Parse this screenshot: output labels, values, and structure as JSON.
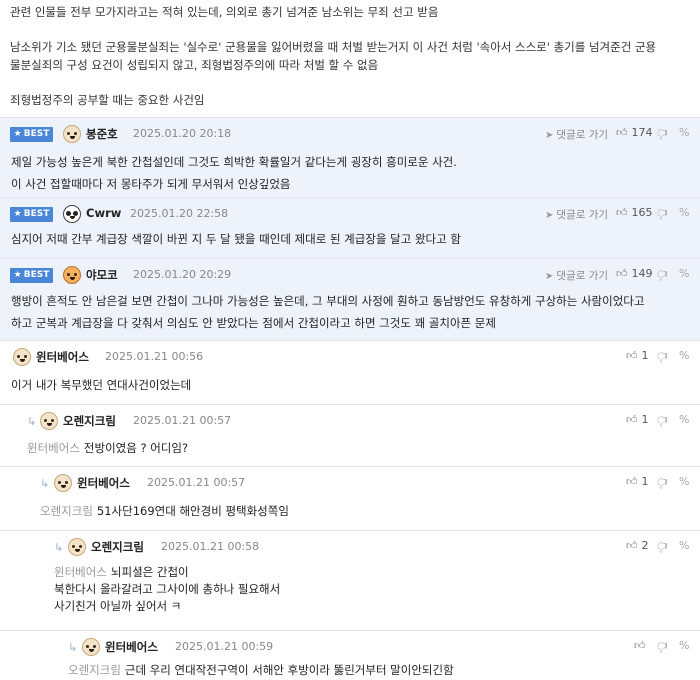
{
  "post_tail": {
    "line1": "관련 인물들 전부 모가지라고는 적혀 있는데, 의외로 총기 넘겨준 남소위는 무죄 선고 받음",
    "line2": "남소위가 기소 됐던 군용물분실죄는 '실수로' 군용물을 잃어버렸을 때 처벌 받는거지 이 사건 처럼 '속아서 스스로' 총기를 넘겨준건 군용",
    "line3": "물분실죄의 구성 요건이 성립되지 않고, 죄형법정주의에 따라 처벌 할 수 없음",
    "line4": "죄형법정주의 공부할 때는 중요한 사건임"
  },
  "ui": {
    "best_label": "BEST",
    "reply_label": "댓글로 가기"
  },
  "comments": [
    {
      "best": true,
      "nick": "봉준호",
      "date": "2025.01.20 20:18",
      "likes": "174",
      "lines": [
        "제일 가능성 높은게 북한 간첩설인데 그것도 희박한 확률일거 같다는게 굉장히 흥미로운 사건.",
        "이 사건 접할때마다 저 몽타주가 되게 무서워서 인상깊었음"
      ]
    },
    {
      "best": true,
      "nick": "Cwrw",
      "date": "2025.01.20 22:58",
      "likes": "165",
      "lines": [
        "심지어 저때 간부 계급장 색깔이 바뀐 지 두 달 됐을 때인데 제대로 된 계급장을 달고 왔다고 함"
      ]
    },
    {
      "best": true,
      "nick": "야모코",
      "date": "2025.01.20 20:29",
      "likes": "149",
      "lines": [
        "행방이 흔적도 안 남은걸 보면 간첩이 그나마 가능성은 높은데, 그 부대의 사정에 훤하고 동남방언도 유창하게 구상하는 사람이었다고",
        "하고 군복과 계급장을 다 갖춰서 의심도 안 받았다는 점에서 간첩이라고 하면 그것도 꽤 골치아픈 문제"
      ]
    },
    {
      "best": false,
      "nick": "윈터베어스",
      "date": "2025.01.21 00:56",
      "likes": "1",
      "mention": "",
      "lines": [
        "이거 내가 복무했던 연대사건이었는데"
      ]
    },
    {
      "best": false,
      "nick": "오렌지크림",
      "date": "2025.01.21 00:57",
      "likes": "1",
      "mention": "윈터베어스",
      "lines": [
        "전방이였음 ? 어디임?"
      ]
    },
    {
      "best": false,
      "nick": "윈터베어스",
      "date": "2025.01.21 00:57",
      "likes": "1",
      "mention": "오렌지크림",
      "lines": [
        "51사단169연대 해안경비 평택화성쪽임"
      ]
    },
    {
      "best": false,
      "nick": "오렌지크림",
      "date": "2025.01.21 00:58",
      "likes": "2",
      "mention": "윈터베어스",
      "lines": [
        "뇌피셜은 간첩이",
        "북한다시 올라갈려고 그사이에 총하나 필요해서",
        "사기친거 아닐까 싶어서 ㅋ"
      ]
    },
    {
      "best": false,
      "nick": "윈터베어스",
      "date": "2025.01.21 00:59",
      "likes": "",
      "mention": "오렌지크림",
      "lines": [
        "근데 우리 연대작전구역이 서해안 후방이라 뚫린거부터 말이안되긴함"
      ]
    }
  ]
}
